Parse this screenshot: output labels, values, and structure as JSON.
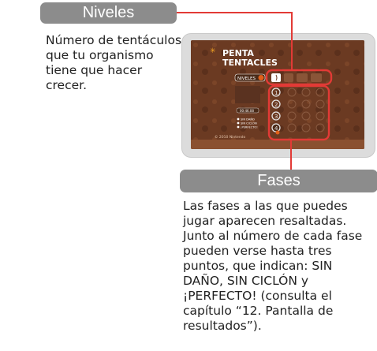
{
  "niveles": {
    "label": "Niveles",
    "description": "Número de tentáculos que tu organismo tiene que hacer crecer."
  },
  "fases": {
    "label": "Fases",
    "description": "Las fases a las que puedes jugar aparecen resaltadas. Junto al número de cada fase pueden verse hasta tres puntos, que indican: SIN DAÑO, SIN CICLÓN y ¡PERFECTO! (consulta el capítulo “12. Pantalla de resultados”)."
  },
  "game_screen": {
    "logo_line1": "PENTA",
    "logo_line2": "TENTACLES",
    "niveles_tab": "NIVELES",
    "level_numbers": [
      "1",
      "2",
      "3",
      "4"
    ],
    "best_time": "00:46.08",
    "legend": [
      "SIN DAÑO",
      "SIN CICLÓN",
      "¡PERFECTO!"
    ],
    "copyright": "© 2010 Nintendo"
  },
  "colors": {
    "accent": "#e23a36",
    "pill": "#8c8c8c",
    "screen_bg": "#6b3a22"
  }
}
